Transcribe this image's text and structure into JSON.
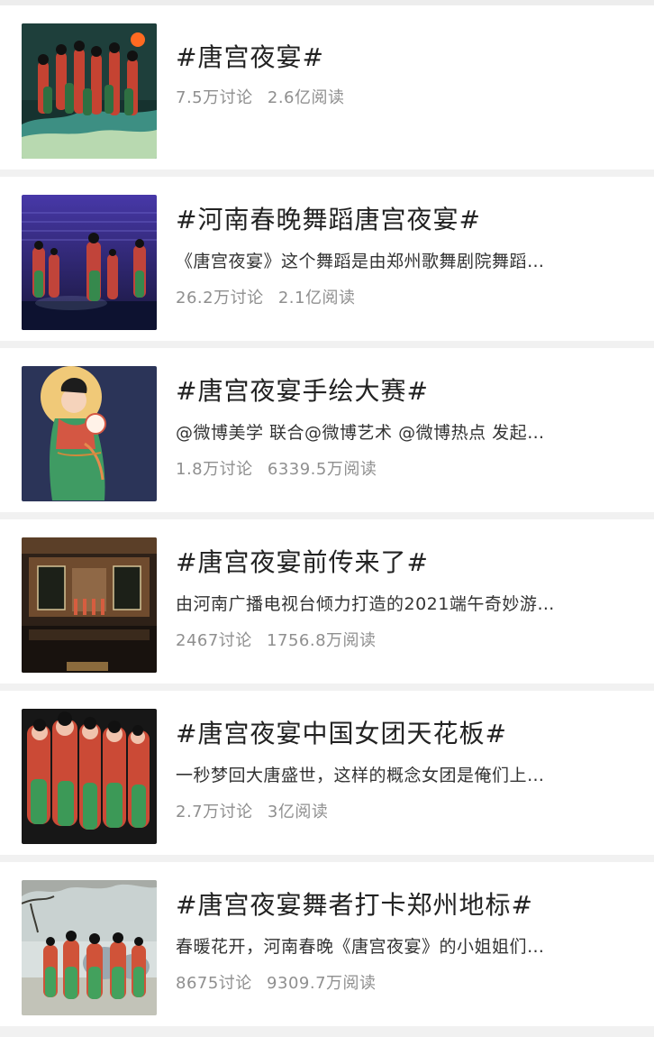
{
  "topics": [
    {
      "title": "#唐宫夜宴#",
      "description": "",
      "discussions": "7.5万讨论",
      "reads": "2.6亿阅读",
      "thumbnail": "dancers-stage-group-icon"
    },
    {
      "title": "#河南春晚舞蹈唐宫夜宴#",
      "description": "《唐宫夜宴》这个舞蹈是由郑州歌舞剧院舞蹈…",
      "discussions": "26.2万讨论",
      "reads": "2.1亿阅读",
      "thumbnail": "dancers-on-stage-icon"
    },
    {
      "title": "#唐宫夜宴手绘大赛#",
      "description": "@微博美学 联合@微博艺术 @微博热点 发起…",
      "discussions": "1.8万讨论",
      "reads": "6339.5万阅读",
      "thumbnail": "illustrated-dancer-moon-icon"
    },
    {
      "title": "#唐宫夜宴前传来了#",
      "description": "由河南广播电视台倾力打造的2021端午奇妙游…",
      "discussions": "2467讨论",
      "reads": "1756.8万阅读",
      "thumbnail": "museum-scene-icon"
    },
    {
      "title": "#唐宫夜宴中国女团天花板#",
      "description": "一秒梦回大唐盛世，这样的概念女团是俺们上…",
      "discussions": "2.7万讨论",
      "reads": "3亿阅读",
      "thumbnail": "dancers-closeup-icon"
    },
    {
      "title": "#唐宫夜宴舞者打卡郑州地标#",
      "description": "春暖花开，河南春晚《唐宫夜宴》的小姐姐们…",
      "discussions": "8675讨论",
      "reads": "9309.7万阅读",
      "thumbnail": "dancers-outdoor-icon"
    }
  ],
  "colors": {
    "title": "#222222",
    "description": "#333333",
    "meta": "#8f8f8f",
    "background": "#f1f1f1",
    "card": "#ffffff"
  }
}
